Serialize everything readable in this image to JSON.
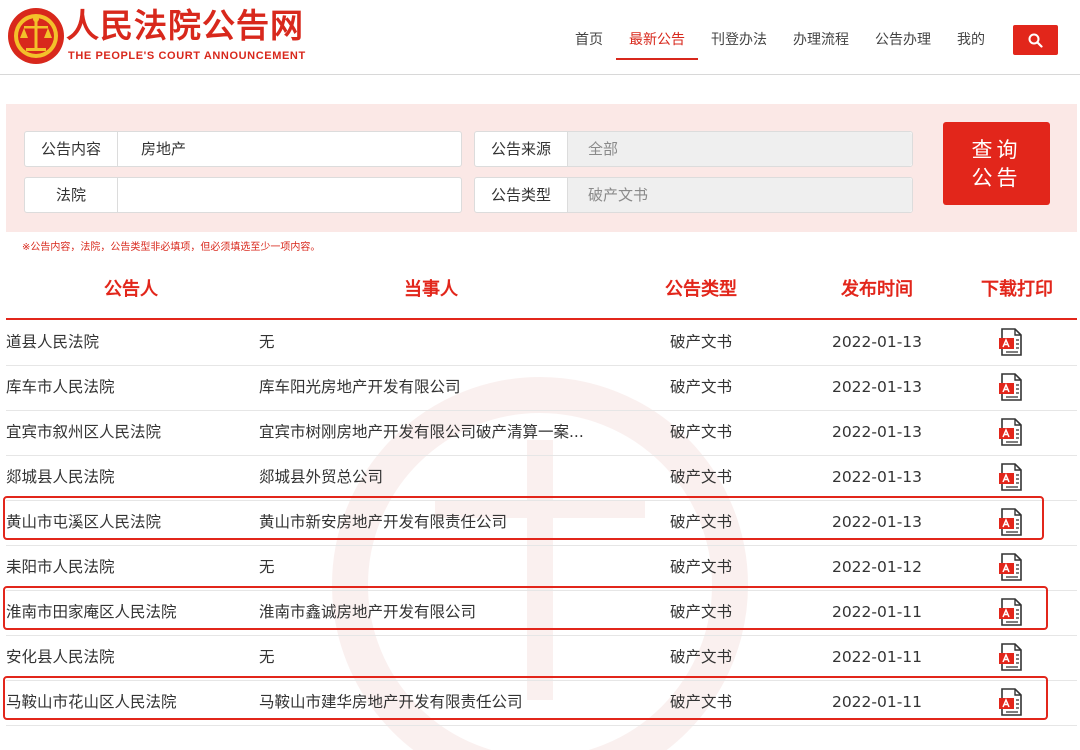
{
  "header": {
    "title": "人民法院公告网",
    "subtitle": "THE PEOPLE'S COURT ANNOUNCEMENT",
    "nav": [
      "首页",
      "最新公告",
      "刊登办法",
      "办理流程",
      "公告办理",
      "我的"
    ],
    "active_nav": "最新公告"
  },
  "filter": {
    "content_label": "公告内容",
    "content_value": "房地产",
    "source_label": "公告来源",
    "source_value": "全部",
    "court_label": "法院",
    "court_value": "",
    "type_label": "公告类型",
    "type_value": "破产文书",
    "query_button": "查询公告",
    "note": "※公告内容，法院，公告类型非必填项，但必须填选至少一项内容。"
  },
  "table": {
    "columns": [
      "公告人",
      "当事人",
      "公告类型",
      "发布时间",
      "下载打印"
    ],
    "rows": [
      {
        "court": "道县人民法院",
        "party": "无",
        "type": "破产文书",
        "date": "2022-01-13"
      },
      {
        "court": "库车市人民法院",
        "party": "库车阳光房地产开发有限公司",
        "type": "破产文书",
        "date": "2022-01-13"
      },
      {
        "court": "宜宾市叙州区人民法院",
        "party": "宜宾市树刚房地产开发有限公司破产清算一案...",
        "type": "破产文书",
        "date": "2022-01-13"
      },
      {
        "court": "郯城县人民法院",
        "party": "郯城县外贸总公司",
        "type": "破产文书",
        "date": "2022-01-13"
      },
      {
        "court": "黄山市屯溪区人民法院",
        "party": "黄山市新安房地产开发有限责任公司",
        "type": "破产文书",
        "date": "2022-01-13"
      },
      {
        "court": "耒阳市人民法院",
        "party": "无",
        "type": "破产文书",
        "date": "2022-01-12"
      },
      {
        "court": "淮南市田家庵区人民法院",
        "party": "淮南市鑫诚房地产开发有限公司",
        "type": "破产文书",
        "date": "2022-01-11"
      },
      {
        "court": "安化县人民法院",
        "party": "无",
        "type": "破产文书",
        "date": "2022-01-11"
      },
      {
        "court": "马鞍山市花山区人民法院",
        "party": "马鞍山市建华房地产开发有限责任公司",
        "type": "破产文书",
        "date": "2022-01-11"
      }
    ],
    "highlighted_rows": [
      4,
      6,
      8
    ]
  },
  "colors": {
    "brand_red": "#e2261b",
    "panel_pink": "#fbe8e6",
    "highlight_border": "#e2261b"
  },
  "icons": {
    "logo": "court-emblem-icon",
    "search": "search-icon",
    "download": "pdf-icon"
  }
}
